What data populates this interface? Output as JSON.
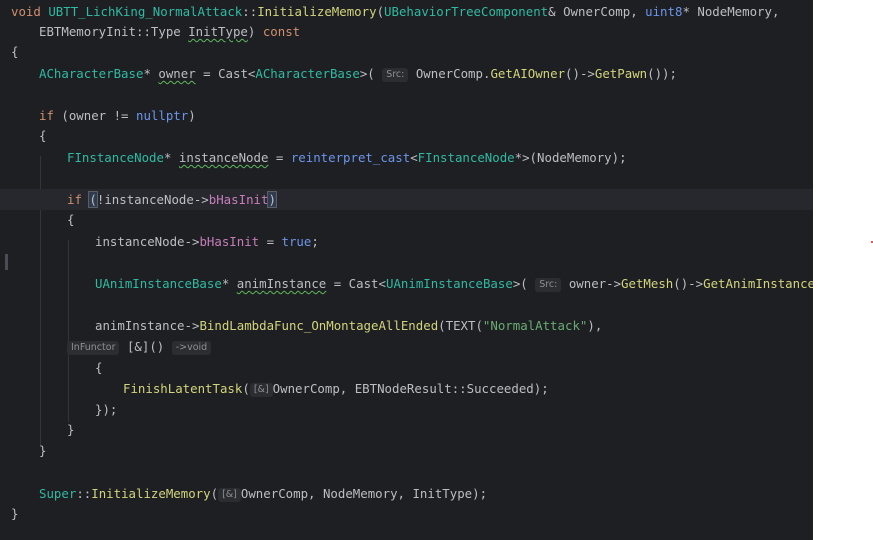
{
  "editor": {
    "l1": {
      "kw": "void",
      "cls": "UBTT_LichKing_NormalAttack",
      "sep": "::",
      "fn": "InitializeMemory",
      "p1t": "UBehaviorTreeComponent",
      "p1r": "& ",
      "p1n": "OwnerComp",
      "c1": ", ",
      "p2t": "uint8",
      "p2r": "* ",
      "p2n": "NodeMemory",
      "c2": ","
    },
    "l2": {
      "t1": "EBTMemoryInit",
      "sep": "::",
      "t2": "Type",
      "pn": "InitType",
      "cl": ") ",
      "kw": "const"
    },
    "l3": {
      "brace": "{"
    },
    "l4": {
      "t": "ACharacterBase",
      "star": "* ",
      "v": "owner",
      "eq": " = ",
      "fn": "Cast",
      "lt": "<",
      "t2": "ACharacterBase",
      "gt": ">(",
      "hint": "Src:",
      "a": "OwnerComp",
      "dot": ".",
      "f2": "GetAIOwner",
      "arr": "()->",
      "f3": "GetPawn",
      "end": "());"
    },
    "l5": {
      "kw": "if",
      "p": " (owner != ",
      "np": "nullptr",
      "end": ")"
    },
    "l6": {
      "brace": "{"
    },
    "l7": {
      "t": "FInstanceNode",
      "star": "* ",
      "v": "instanceNode",
      "eq": " = ",
      "kw": "reinterpret_cast",
      "lt": "<",
      "t2": "FInstanceNode",
      "gt": "*>(NodeMemory);"
    },
    "l8": {
      "kw": "if",
      "sp": " ",
      "ob": "(",
      "p": "!instanceNode->",
      "m": "bHasInit",
      "cb": ")"
    },
    "l9": {
      "brace": "{"
    },
    "l10": {
      "a": "instanceNode->",
      "m": "bHasInit",
      "eq": " = ",
      "lit": "true",
      "end": ";"
    },
    "l11": {
      "t": "UAnimInstanceBase",
      "star": "* ",
      "v": "animInstance",
      "eq": " = ",
      "fn": "Cast",
      "lt": "<",
      "t2": "UAnimInstanceBase",
      "gt": ">(",
      "hint": "Src:",
      "a": "owner->",
      "f2": "GetMesh",
      "arr": "()->",
      "f3": "GetAnimInstance",
      "end": "());"
    },
    "l12": {
      "a": "animInstance->",
      "fn": "BindLambdaFunc_OnMontageAllEnded",
      "op": "(TEXT(",
      "str": "\"NormalAttack\"",
      "end": "),"
    },
    "l13": {
      "hint": "InFunctor",
      "cap": " [&]() ",
      "ret": "->void"
    },
    "l14": {
      "brace": "{"
    },
    "l15": {
      "fn": "FinishLatentTask",
      "op": "(",
      "hint": "[&]",
      "a": "OwnerComp",
      "c": ", ",
      "e": "EBTNodeResult",
      "sep": "::",
      "m": "Succeeded",
      "end": ");"
    },
    "l16": {
      "brace": "});"
    },
    "l17": {
      "brace": "}"
    },
    "l18": {
      "brace": "}"
    },
    "l19": {
      "cls": "Super",
      "sep": "::",
      "fn": "InitializeMemory",
      "op": "(",
      "hint": "[&]",
      "a": "OwnerComp",
      "rest": ", NodeMemory, InitType);"
    },
    "l20": {
      "brace": "}"
    }
  }
}
